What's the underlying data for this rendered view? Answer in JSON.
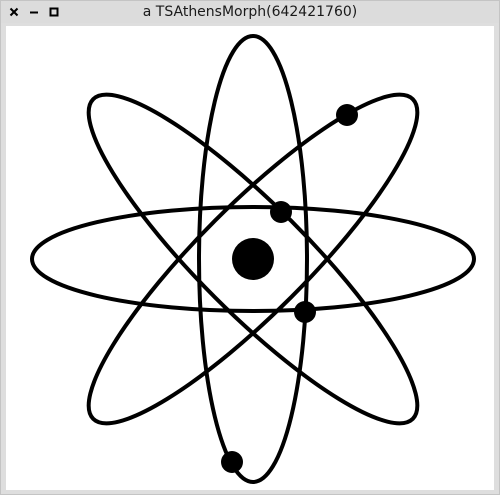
{
  "window": {
    "title": "a TSAthensMorph(642421760)",
    "controls": {
      "close_icon": "close-icon",
      "minimize_icon": "minimize-icon",
      "maximize_icon": "maximize-icon"
    }
  },
  "morph": {
    "background": "#ffffff",
    "stroke": "#000000",
    "orbit_count": 4,
    "electron_count": 4
  }
}
